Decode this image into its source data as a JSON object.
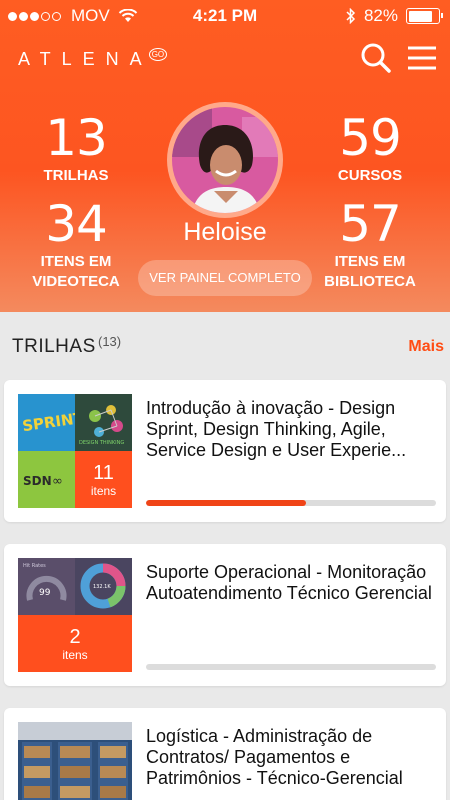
{
  "status_bar": {
    "carrier": "MOV",
    "time": "4:21 PM",
    "battery_text": "82%",
    "battery_level": 0.82
  },
  "header": {
    "logo": "ATLENA",
    "logo_mark": "GO",
    "icons": [
      "search-icon",
      "hamburger-menu-icon"
    ]
  },
  "profile": {
    "name": "Heloise",
    "panel_button": "VER PAINEL COMPLETO"
  },
  "stats": [
    {
      "value": "13",
      "label": "TRILHAS"
    },
    {
      "value": "59",
      "label": "CURSOS"
    },
    {
      "value": "34",
      "label": "ITENS EM VIDEOTECA"
    },
    {
      "value": "57",
      "label": "ITENS EM BIBLIOTECA"
    }
  ],
  "section": {
    "title": "TRILHAS",
    "count": "(13)",
    "more": "Mais"
  },
  "trails": [
    {
      "title": "Introdução à inovação - Design Sprint, Design Thinking, Agile, Service Design e User Experie...",
      "count": "11",
      "count_label": "itens",
      "progress": 0.55,
      "thumb_labels": [
        "SPRINT",
        "DESIGN THINKING",
        "SDN"
      ]
    },
    {
      "title": "Suporte Operacional - Monitoração Autoatendimento Técnico Gerencial",
      "count": "2",
      "count_label": "itens",
      "progress": 0,
      "thumb_labels": [
        "Hit Rates",
        "99",
        "132.1K"
      ]
    },
    {
      "title": "Logística - Administração de Contratos/ Pagamentos e Patrimônios - Técnico-Gerencial",
      "progress": 0
    }
  ],
  "colors": {
    "accent": "#ff4d15",
    "header_top": "#ff5d22",
    "header_bottom": "#f48a5e",
    "background": "#e9e9e9"
  }
}
